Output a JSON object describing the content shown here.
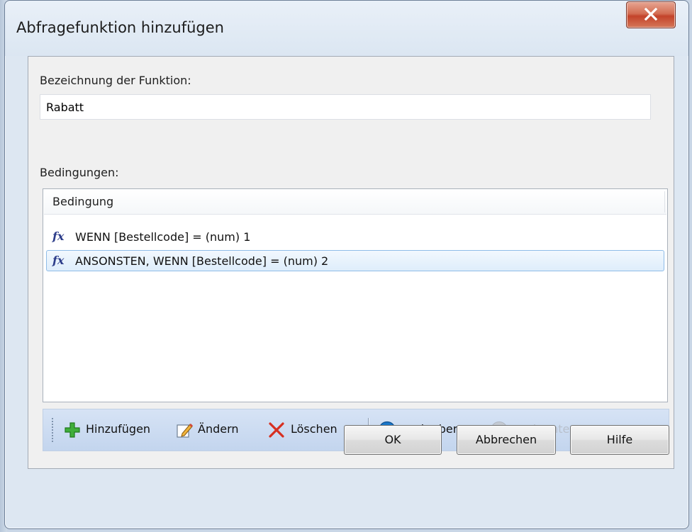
{
  "window": {
    "title": "Abfragefunktion hinzufügen",
    "close_icon": "close-icon"
  },
  "form": {
    "name_label": "Bezeichnung der Funktion:",
    "name_value": "Rabatt",
    "conditions_label": "Bedingungen:"
  },
  "list": {
    "column_header": "Bedingung",
    "rows": [
      {
        "icon": "fx-icon",
        "text": "WENN [Bestellcode] = (num) 1",
        "selected": false
      },
      {
        "icon": "fx-icon",
        "text": "ANSONSTEN, WENN [Bestellcode] = (num) 2",
        "selected": true
      }
    ]
  },
  "toolbar": {
    "add_label": "Hinzufügen",
    "edit_label": "Ändern",
    "delete_label": "Löschen",
    "up_label": "nach oben",
    "down_label": "nach unten",
    "down_disabled": true
  },
  "buttons": {
    "ok_label": "OK",
    "cancel_label": "Abbrechen",
    "help_label": "Hilfe"
  },
  "colors": {
    "selection_border": "#8fbce8",
    "toolbar_bg": "#c9daf0",
    "close_button": "#c3432a"
  }
}
